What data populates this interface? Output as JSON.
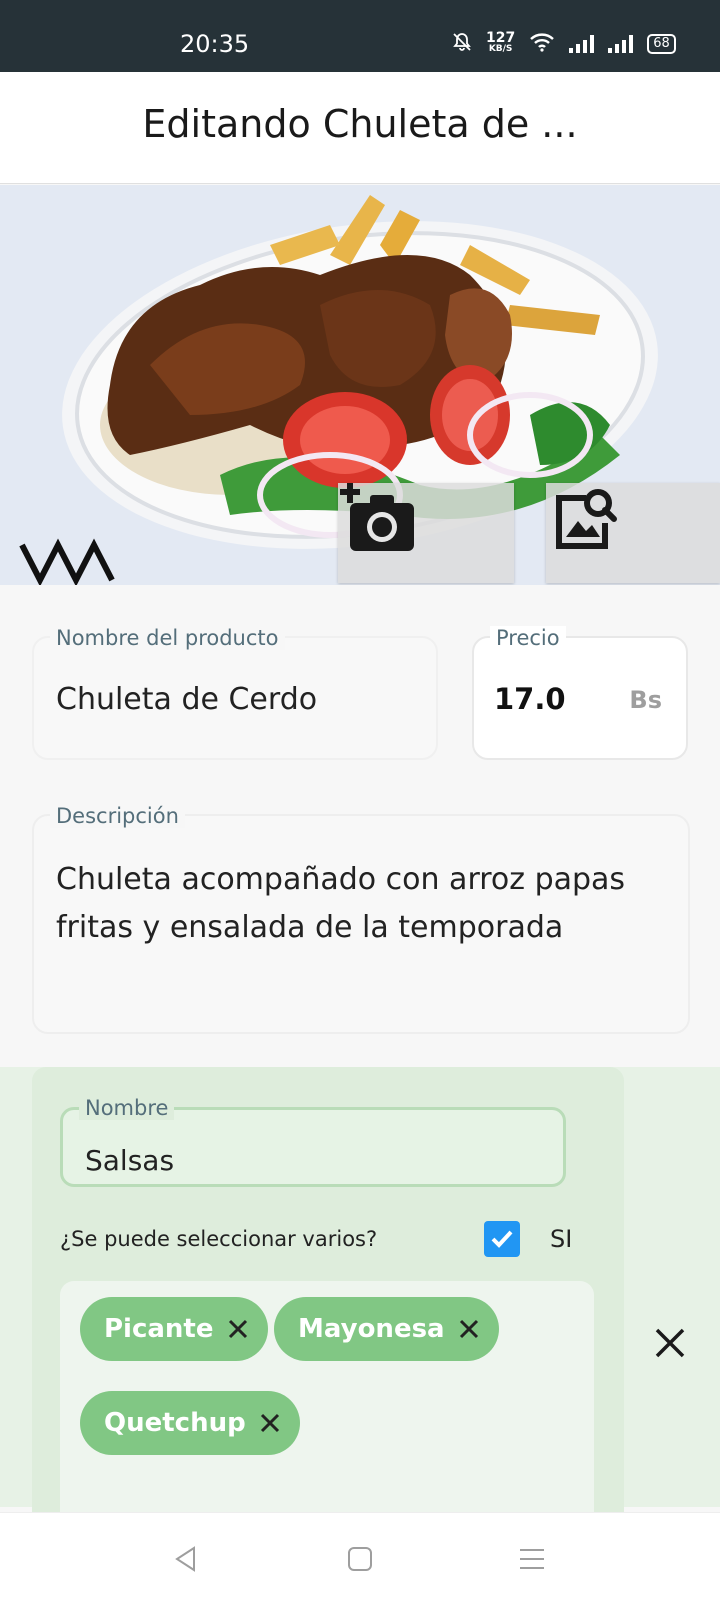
{
  "status_bar": {
    "time": "20:35",
    "net_speed": "127",
    "net_unit": "KB/S",
    "battery": "68",
    "icons": [
      "bell-off-icon",
      "wifi-icon",
      "signal-icon",
      "signal-icon",
      "battery-icon"
    ]
  },
  "app_bar": {
    "title": "Editando Chuleta de ..."
  },
  "hero": {
    "image": "plate-photo",
    "camera_button_icon": "add-camera-icon",
    "gallery_button_icon": "image-search-icon"
  },
  "form": {
    "name": {
      "label": "Nombre del producto",
      "value": "Chuleta de Cerdo"
    },
    "price": {
      "label": "Precio",
      "value": "17.0",
      "unit": "Bs"
    },
    "description": {
      "label": "Descripción",
      "value": "Chuleta acompañado con arroz papas fritas y ensalada de la temporada"
    }
  },
  "option_group": {
    "name": {
      "label": "Nombre",
      "value": "Salsas"
    },
    "multi_select": {
      "question": "¿Se puede seleccionar varios?",
      "checked": true,
      "answer": "SI"
    },
    "chips": [
      {
        "label": "Picante"
      },
      {
        "label": "Mayonesa"
      },
      {
        "label": "Quetchup"
      }
    ],
    "delete_icon": "close-icon"
  },
  "nav_bar": {
    "buttons": [
      "back-icon",
      "home-icon",
      "menu-icon"
    ]
  },
  "colors": {
    "status_bar": "#263238",
    "chip": "#81c784",
    "checkbox": "#2196f3",
    "group_card": "#deeddc"
  }
}
